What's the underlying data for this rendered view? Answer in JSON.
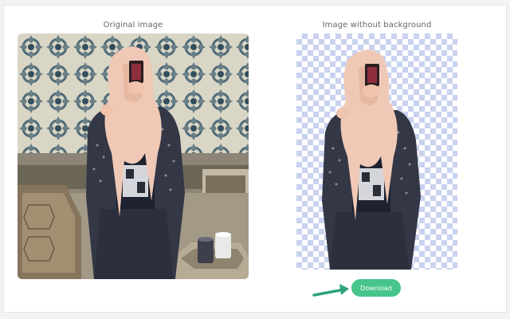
{
  "captions": {
    "original": "Original image",
    "result": "Image without background"
  },
  "actions": {
    "download_label": "Download"
  },
  "colors": {
    "accent": "#47c58a",
    "arrow": "#2ea37c",
    "checker": "#c9d2ee"
  },
  "icons": {
    "arrow": "arrow-right-icon"
  }
}
